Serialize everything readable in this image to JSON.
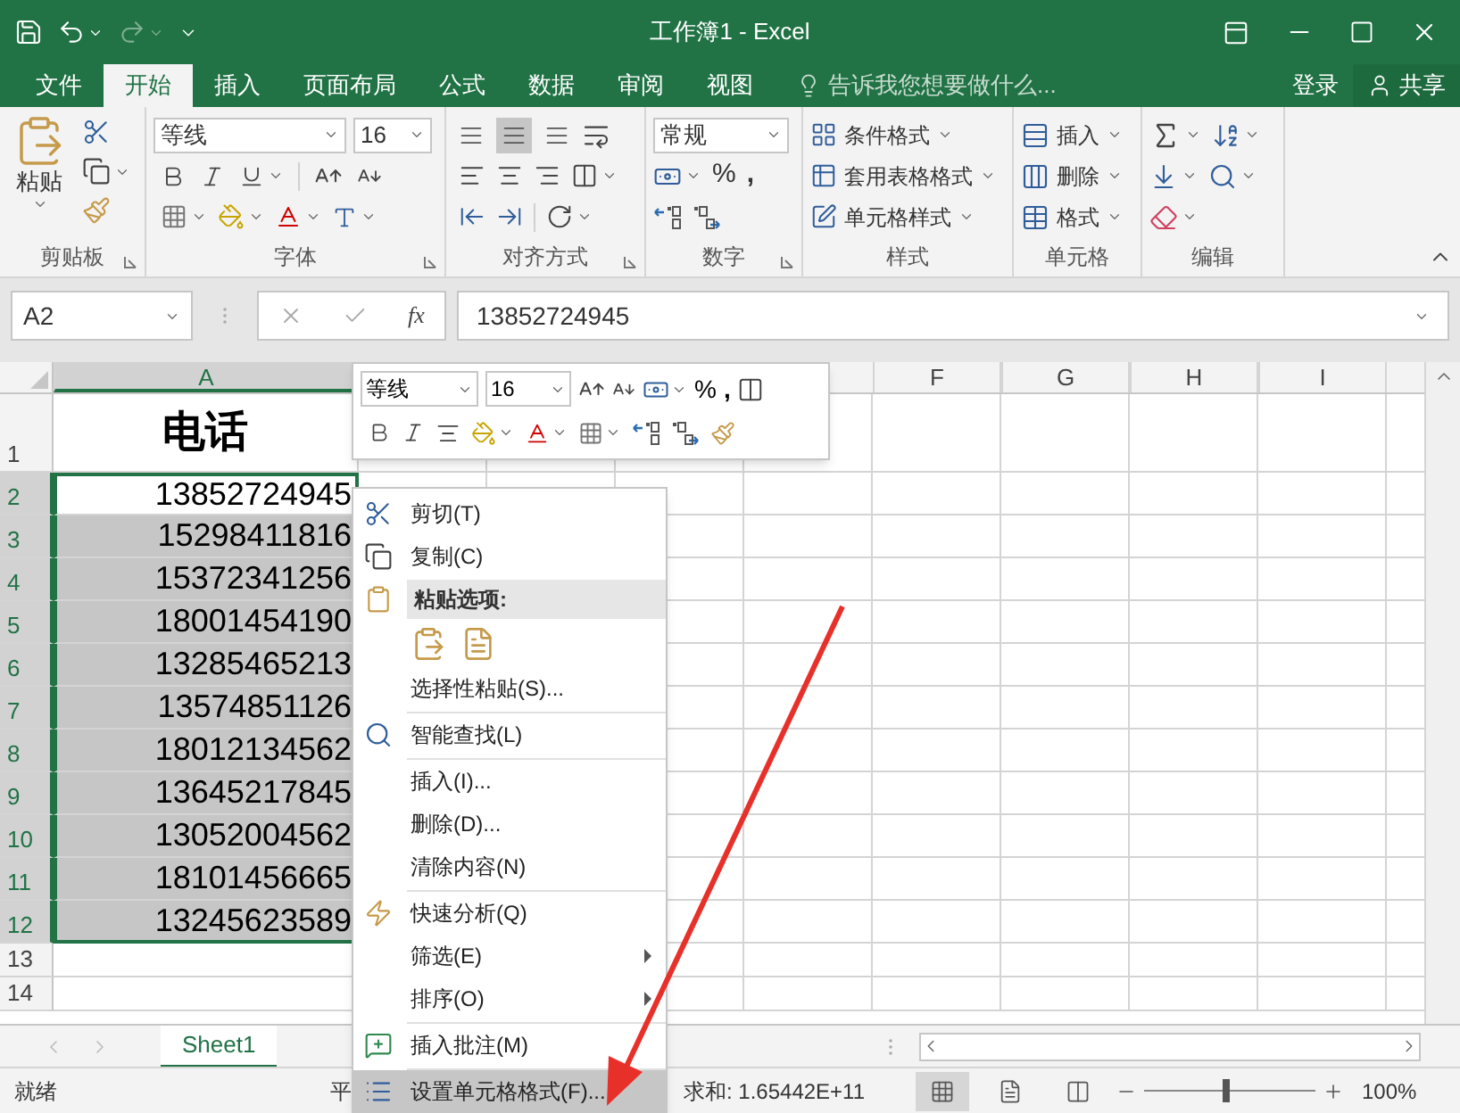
{
  "window": {
    "title": "工作簿1 - Excel"
  },
  "ribbon_tabs": [
    {
      "label": "文件",
      "selected": false
    },
    {
      "label": "开始",
      "selected": true
    },
    {
      "label": "插入",
      "selected": false
    },
    {
      "label": "页面布局",
      "selected": false
    },
    {
      "label": "公式",
      "selected": false
    },
    {
      "label": "数据",
      "selected": false
    },
    {
      "label": "审阅",
      "selected": false
    },
    {
      "label": "视图",
      "selected": false
    }
  ],
  "tell_me": {
    "placeholder": "告诉我您想要做什么..."
  },
  "account": {
    "sign_in": "登录",
    "share": "共享"
  },
  "clipboard": {
    "label": "剪贴板",
    "paste": "粘贴"
  },
  "font": {
    "label": "字体",
    "name": "等线",
    "size": "16"
  },
  "alignment": {
    "label": "对齐方式",
    "vertical": [
      {
        "selected": false
      },
      {
        "selected": true
      },
      {
        "selected": false
      }
    ]
  },
  "number": {
    "label": "数字",
    "format": "常规",
    "percent": "%",
    "comma": ","
  },
  "styles": {
    "label": "样式",
    "items": [
      "条件格式",
      "套用表格格式",
      "单元格样式"
    ]
  },
  "cells": {
    "label": "单元格",
    "items": [
      "插入",
      "删除",
      "格式"
    ]
  },
  "editing": {
    "label": "编辑"
  },
  "formula_bar": {
    "name_box": "A2",
    "function_label": "fx",
    "value": "13852724945"
  },
  "columns": [
    {
      "label": "A",
      "selected": true
    },
    {
      "label": "F",
      "selected": false
    },
    {
      "label": "G",
      "selected": false
    },
    {
      "label": "H",
      "selected": false
    },
    {
      "label": "I",
      "selected": false
    }
  ],
  "rows": [
    {
      "header": "1",
      "kind": "title",
      "cell": "电话",
      "selected": false,
      "active": false
    },
    {
      "header": "2",
      "kind": "value",
      "cell": "13852724945",
      "selected": true,
      "active": true
    },
    {
      "header": "3",
      "kind": "value",
      "cell": "15298411816",
      "selected": true,
      "active": false
    },
    {
      "header": "4",
      "kind": "value",
      "cell": "15372341256",
      "selected": true,
      "active": false
    },
    {
      "header": "5",
      "kind": "value",
      "cell": "18001454190",
      "selected": true,
      "active": false
    },
    {
      "header": "6",
      "kind": "value",
      "cell": "13285465213",
      "selected": true,
      "active": false
    },
    {
      "header": "7",
      "kind": "value",
      "cell": "13574851126",
      "selected": true,
      "active": false
    },
    {
      "header": "8",
      "kind": "value",
      "cell": "18012134562",
      "selected": true,
      "active": false
    },
    {
      "header": "9",
      "kind": "value",
      "cell": "13645217845",
      "selected": true,
      "active": false
    },
    {
      "header": "10",
      "kind": "value",
      "cell": "13052004562",
      "selected": true,
      "active": false
    },
    {
      "header": "11",
      "kind": "value",
      "cell": "18101456665",
      "selected": true,
      "active": false
    },
    {
      "header": "12",
      "kind": "value",
      "cell": "13245623589",
      "selected": true,
      "active": false
    },
    {
      "header": "13",
      "kind": "empty",
      "selected": false
    },
    {
      "header": "14",
      "kind": "empty",
      "selected": false
    }
  ],
  "mini_toolbar": {
    "font": "等线",
    "size": "16",
    "percent": "%",
    "comma": ","
  },
  "context_menu": {
    "items": [
      {
        "kind": "item",
        "label": "剪切(T)",
        "submenu": false,
        "selected": false
      },
      {
        "kind": "item",
        "label": "复制(C)",
        "submenu": false,
        "selected": false
      },
      {
        "kind": "heading",
        "label": "粘贴选项:"
      },
      {
        "kind": "paste_options"
      },
      {
        "kind": "item",
        "label": "选择性粘贴(S)...",
        "submenu": false,
        "selected": false
      },
      {
        "kind": "separator"
      },
      {
        "kind": "item",
        "label": "智能查找(L)",
        "submenu": false,
        "selected": false
      },
      {
        "kind": "separator"
      },
      {
        "kind": "item",
        "label": "插入(I)...",
        "submenu": false,
        "selected": false
      },
      {
        "kind": "item",
        "label": "删除(D)...",
        "submenu": false,
        "selected": false
      },
      {
        "kind": "item",
        "label": "清除内容(N)",
        "submenu": false,
        "selected": false
      },
      {
        "kind": "separator"
      },
      {
        "kind": "item",
        "label": "快速分析(Q)",
        "submenu": false,
        "selected": false
      },
      {
        "kind": "item",
        "label": "筛选(E)",
        "submenu": true,
        "selected": false
      },
      {
        "kind": "item",
        "label": "排序(O)",
        "submenu": true,
        "selected": false
      },
      {
        "kind": "separator"
      },
      {
        "kind": "item",
        "label": "插入批注(M)",
        "submenu": false,
        "selected": false
      },
      {
        "kind": "separator"
      },
      {
        "kind": "item",
        "label": "设置单元格格式(F)...",
        "submenu": false,
        "selected": true
      }
    ]
  },
  "sheet_tabs": [
    {
      "label": "Sheet1",
      "selected": true
    }
  ],
  "status_bar": {
    "mode": "就绪",
    "average": "平",
    "sum": "求和: 1.65442E+11",
    "views": [
      {
        "selected": true
      },
      {
        "selected": false
      },
      {
        "selected": false
      }
    ],
    "zoom": {
      "level": 0.48,
      "reading": "100%"
    }
  }
}
